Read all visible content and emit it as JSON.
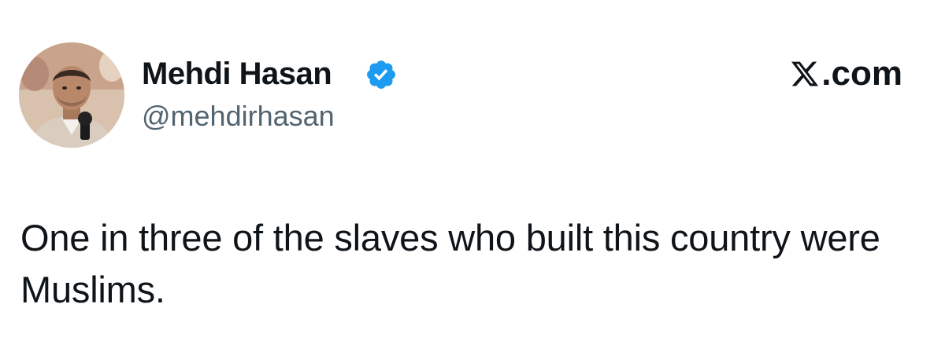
{
  "author": {
    "name": "Mehdi Hasan",
    "handle": "@mehdirhasan",
    "verified": true,
    "badge_color": "#1d9bf0",
    "avatar_icon": "profile-photo"
  },
  "site": {
    "logo_icon": "x-logo-icon",
    "domain": ".com"
  },
  "post": {
    "text": "One in three of the slaves who built this country were Muslims."
  },
  "colors": {
    "text_primary": "#0f1419",
    "text_secondary": "#536471",
    "background": "#ffffff"
  }
}
